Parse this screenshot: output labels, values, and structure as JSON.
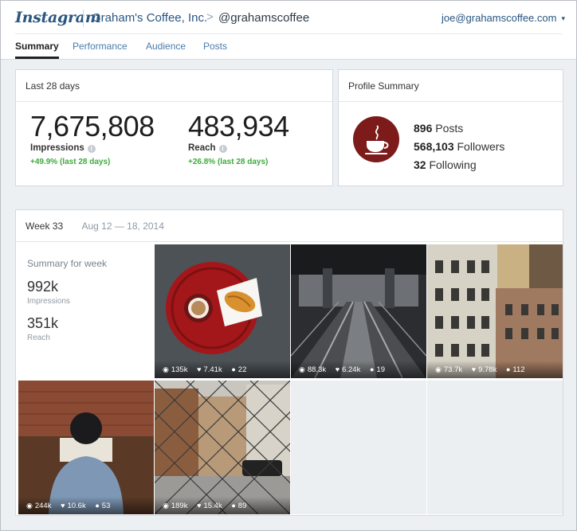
{
  "header": {
    "logo": "Instagram",
    "company": "Graham's Coffee, Inc.",
    "separator": ">",
    "handle": "@grahamscoffee",
    "account_email": "joe@grahamscoffee.com",
    "account_caret": "▾"
  },
  "tabs": [
    {
      "label": "Summary",
      "active": true
    },
    {
      "label": "Performance",
      "active": false
    },
    {
      "label": "Audience",
      "active": false
    },
    {
      "label": "Posts",
      "active": false
    }
  ],
  "last28": {
    "title": "Last 28 days",
    "impressions": {
      "value": "7,675,808",
      "label": "Impressions",
      "delta": "+49.9% (last 28 days)"
    },
    "reach": {
      "value": "483,934",
      "label": "Reach",
      "delta": "+26.8% (last 28 days)"
    },
    "info_glyph": "i"
  },
  "profile": {
    "title": "Profile Summary",
    "icon": "coffee-cup-icon",
    "posts": {
      "count": "896",
      "label": "Posts"
    },
    "followers": {
      "count": "568,103",
      "label": "Followers"
    },
    "following": {
      "count": "32",
      "label": "Following"
    },
    "brand_color": "#7d1a1a"
  },
  "week": {
    "title": "Week 33",
    "range": "Aug 12 — 18, 2014",
    "summary_title": "Summary for week",
    "impressions": {
      "value": "992k",
      "label": "Impressions"
    },
    "reach": {
      "value": "351k",
      "label": "Reach"
    }
  },
  "posts": [
    {
      "views": "135k",
      "likes": "7.41k",
      "comments": "22",
      "subject": "coffee-and-croissant"
    },
    {
      "views": "88.3k",
      "likes": "6.24k",
      "comments": "19",
      "subject": "train-tracks"
    },
    {
      "views": "73.7k",
      "likes": "9.78k",
      "comments": "112",
      "subject": "city-buildings"
    },
    {
      "views": "244k",
      "likes": "10.6k",
      "comments": "53",
      "subject": "man-reading"
    },
    {
      "views": "189k",
      "likes": "15.4k",
      "comments": "89",
      "subject": "street-through-fence"
    }
  ],
  "colors": {
    "link": "#4a7bab",
    "positive": "#3eaa3c",
    "brand": "#2a5680"
  }
}
